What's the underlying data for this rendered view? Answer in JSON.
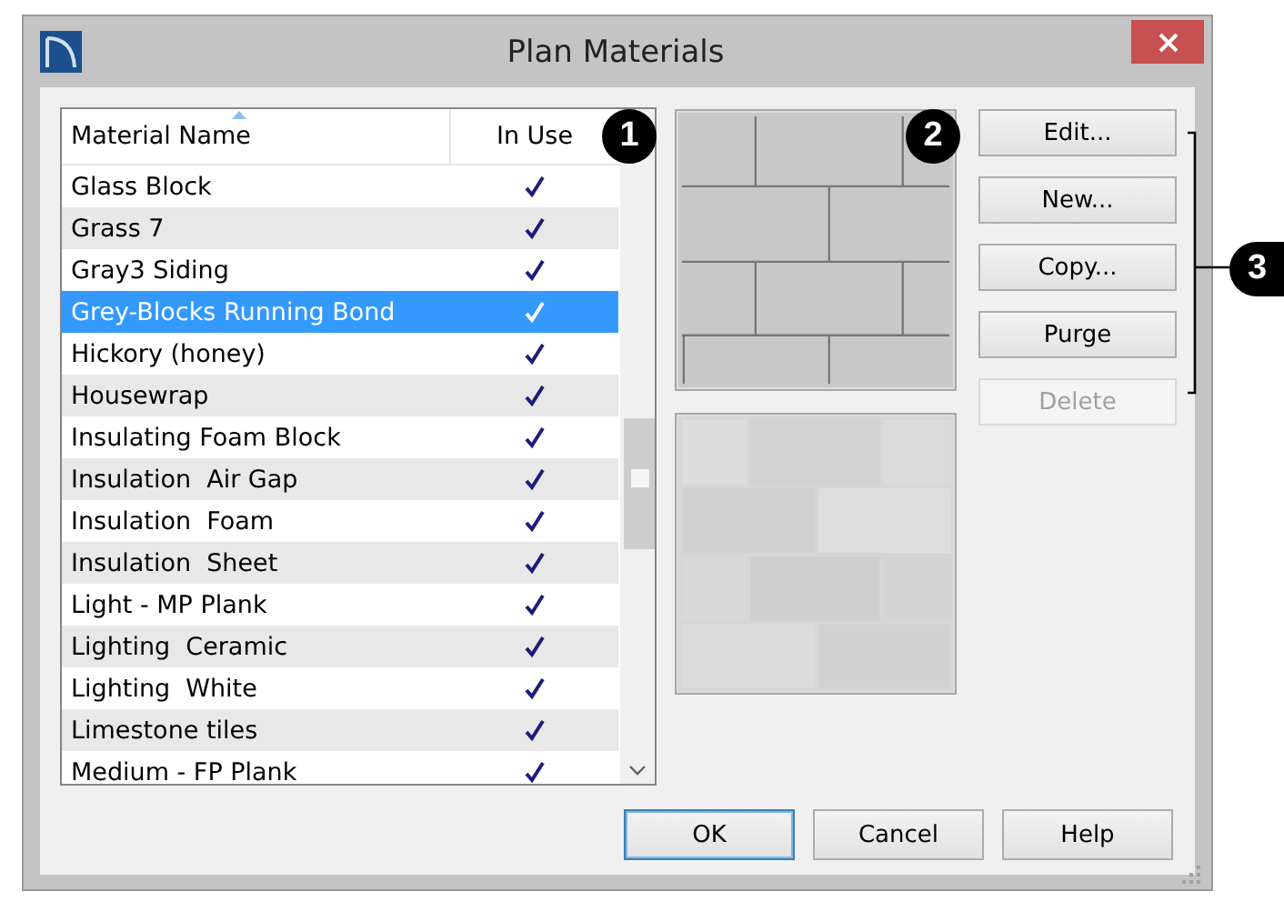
{
  "window": {
    "title": "Plan Materials"
  },
  "table": {
    "columns": [
      {
        "label": "Material Name",
        "sorted": true
      },
      {
        "label": "In Use",
        "sorted": false
      }
    ],
    "rows": [
      {
        "name": "Glass Block",
        "in_use": true,
        "selected": false
      },
      {
        "name": "Grass 7",
        "in_use": true,
        "selected": false
      },
      {
        "name": "Gray3 Siding",
        "in_use": true,
        "selected": false
      },
      {
        "name": "Grey-Blocks Running Bond",
        "in_use": true,
        "selected": true
      },
      {
        "name": "Hickory (honey)",
        "in_use": true,
        "selected": false
      },
      {
        "name": "Housewrap",
        "in_use": true,
        "selected": false
      },
      {
        "name": "Insulating Foam Block",
        "in_use": true,
        "selected": false
      },
      {
        "name": "Insulation  Air Gap",
        "in_use": true,
        "selected": false
      },
      {
        "name": "Insulation  Foam",
        "in_use": true,
        "selected": false
      },
      {
        "name": "Insulation  Sheet",
        "in_use": true,
        "selected": false
      },
      {
        "name": "Light - MP Plank",
        "in_use": true,
        "selected": false
      },
      {
        "name": "Lighting  Ceramic",
        "in_use": true,
        "selected": false
      },
      {
        "name": "Lighting  White",
        "in_use": true,
        "selected": false
      },
      {
        "name": "Limestone tiles",
        "in_use": true,
        "selected": false
      },
      {
        "name": "Medium - FP Plank",
        "in_use": true,
        "selected": false
      }
    ]
  },
  "previews": [
    {
      "kind": "pattern"
    },
    {
      "kind": "picture"
    }
  ],
  "side_buttons": [
    {
      "label": "Edit...",
      "disabled": false
    },
    {
      "label": "New...",
      "disabled": false
    },
    {
      "label": "Copy...",
      "disabled": false
    },
    {
      "label": "Purge",
      "disabled": false
    },
    {
      "label": "Delete",
      "disabled": true
    }
  ],
  "footer_buttons": [
    {
      "label": "OK",
      "default": true
    },
    {
      "label": "Cancel",
      "default": false
    },
    {
      "label": "Help",
      "default": false
    }
  ],
  "callouts": [
    "1",
    "2",
    "3"
  ]
}
